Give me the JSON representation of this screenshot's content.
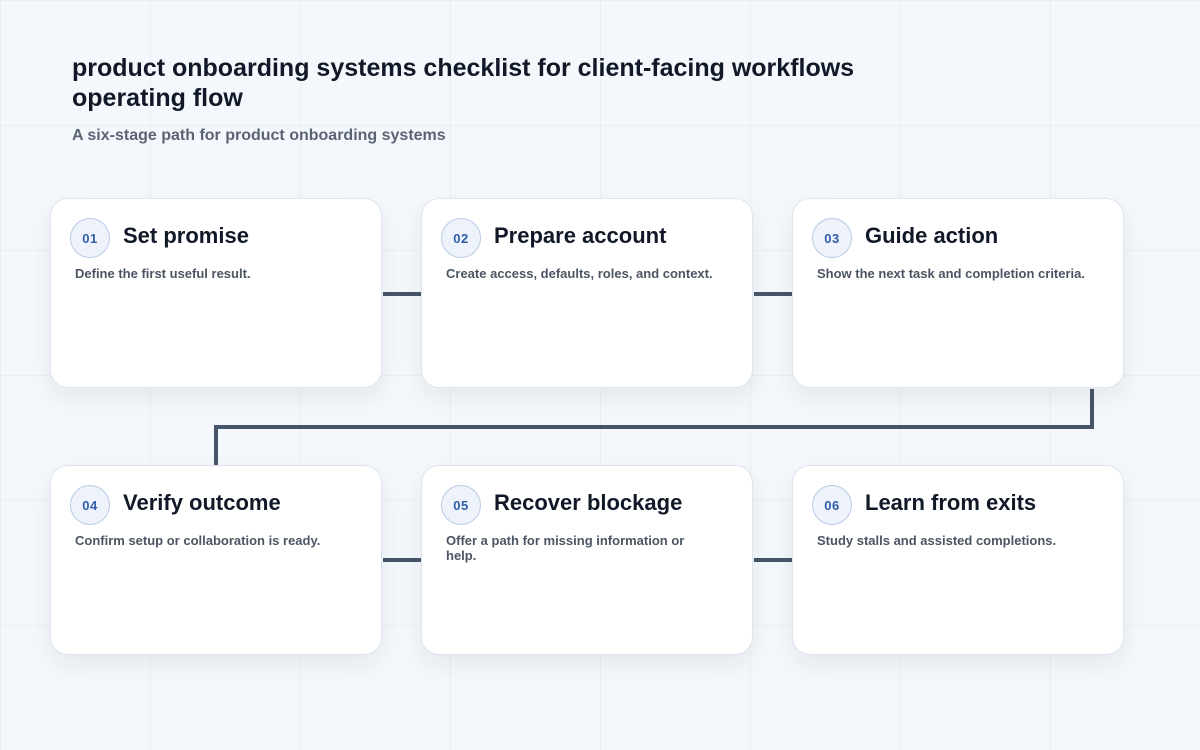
{
  "header": {
    "title": "product onboarding systems checklist for client-facing workflows operating flow",
    "subtitle": "A six-stage path for product onboarding systems"
  },
  "colors": {
    "connector": "#475569",
    "badge_text": "#2f5da8",
    "badge_border": "#b9cbe7"
  },
  "steps": [
    {
      "num": "01",
      "title": "Set promise",
      "desc": "Define the first useful result."
    },
    {
      "num": "02",
      "title": "Prepare account",
      "desc": "Create access, defaults, roles, and context."
    },
    {
      "num": "03",
      "title": "Guide action",
      "desc": "Show the next task and completion criteria."
    },
    {
      "num": "04",
      "title": "Verify outcome",
      "desc": "Confirm setup or collaboration is ready."
    },
    {
      "num": "05",
      "title": "Recover blockage",
      "desc": "Offer a path for missing information or help."
    },
    {
      "num": "06",
      "title": "Learn from exits",
      "desc": "Study stalls and assisted completions."
    }
  ]
}
